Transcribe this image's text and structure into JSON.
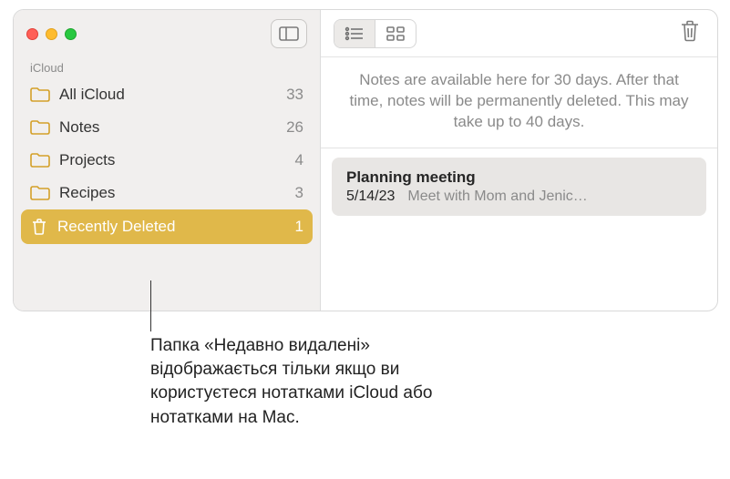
{
  "sidebar": {
    "section_label": "iCloud",
    "items": [
      {
        "label": "All iCloud",
        "count": "33"
      },
      {
        "label": "Notes",
        "count": "26"
      },
      {
        "label": "Projects",
        "count": "4"
      },
      {
        "label": "Recipes",
        "count": "3"
      },
      {
        "label": "Recently Deleted",
        "count": "1"
      }
    ]
  },
  "banner": {
    "text": "Notes are available here for 30 days. After that time, notes will be permanently deleted. This may take up to 40 days."
  },
  "notes": [
    {
      "title": "Planning meeting",
      "date": "5/14/23",
      "snippet": "Meet with Mom and Jenic…"
    }
  ],
  "callout": {
    "text": "Папка «Недавно видалені» відображається тільки якщо ви користуєтеся нотатками iCloud або нотатками на Mac."
  }
}
